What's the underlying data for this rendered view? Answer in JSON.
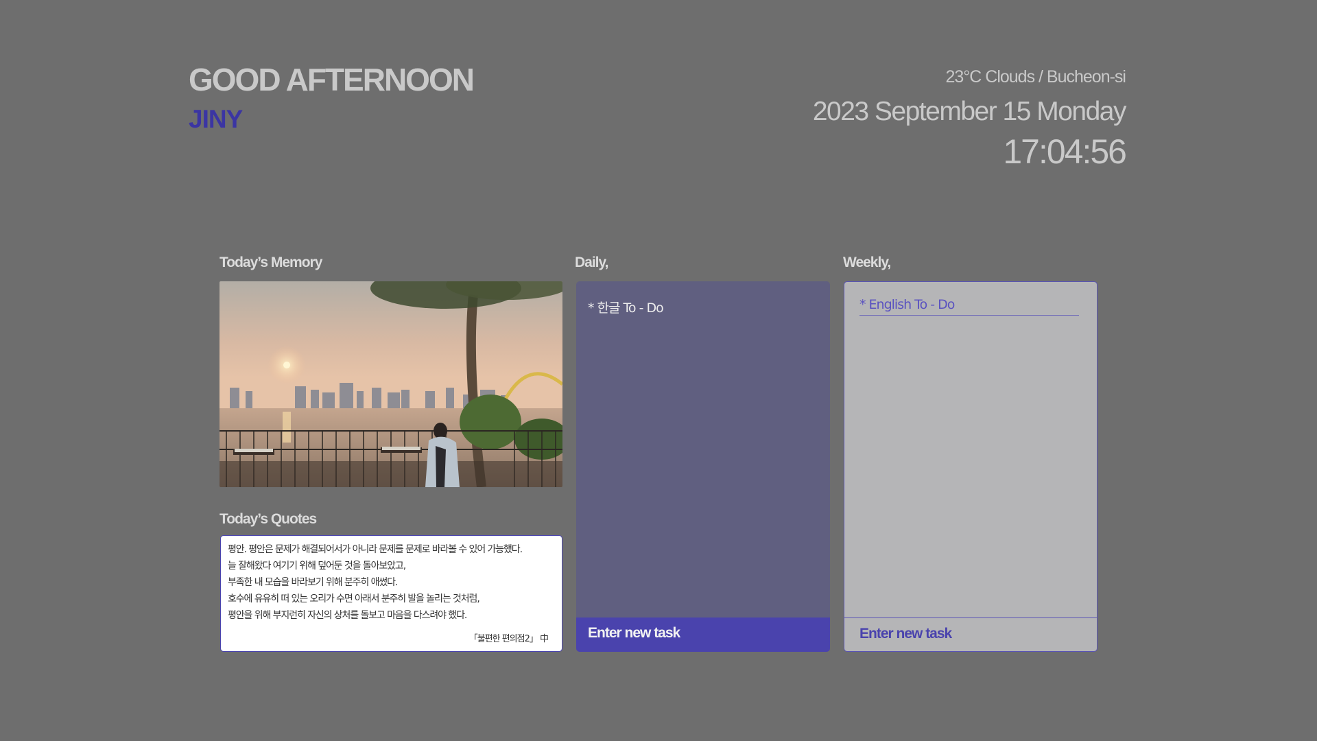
{
  "greeting": {
    "title": "GOOD AFTERNOON",
    "name": "JINY"
  },
  "info": {
    "weather": "23°C Clouds / Bucheon-si",
    "date": "2023 September 15 Monday",
    "time": "17:04:56"
  },
  "memory": {
    "label": "Today’s Memory"
  },
  "quotes": {
    "label": "Today’s Quotes",
    "lines": [
      "평안. 평안은 문제가 해결되어서가 아니라 문제를 문제로 바라볼 수 있어 가능했다.",
      "늘 잘해왔다 여기기 위해 덮어둔 것을 돌아보았고,",
      "부족한 내 모습을 바라보기 위해 분주히 애썼다.",
      "호수에 유유히 떠 있는 오리가 수면 아래서 분주히 발을 놀리는 것처럼,",
      "평안을 위해 부지런히 자신의 상처를 돌보고 마음을 다스려야 했다."
    ],
    "source": "「불편한 편의점2」 中"
  },
  "daily": {
    "label": "Daily,",
    "items": [
      "* 한글 To - Do"
    ],
    "input_placeholder": "Enter new task"
  },
  "weekly": {
    "label": "Weekly,",
    "items": [
      "* English To - Do"
    ],
    "input_placeholder": "Enter new task"
  },
  "colors": {
    "background": "#6e6e6e",
    "accent": "#4a43ad",
    "daily_panel": "#605f80",
    "weekly_panel": "#b5b5b7"
  }
}
